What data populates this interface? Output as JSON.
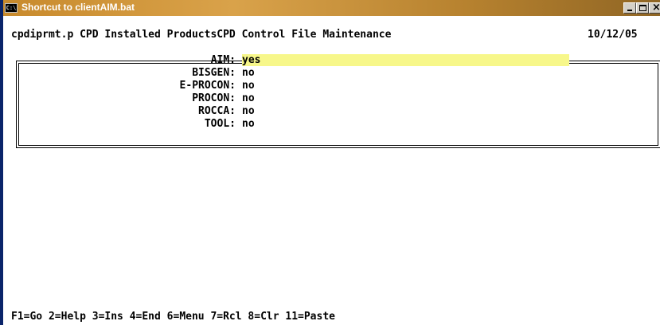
{
  "window": {
    "title": "Shortcut to clientAIM.bat",
    "icon": "C:\\",
    "controls": [
      "minimize-icon",
      "maximize-icon",
      "close-icon"
    ]
  },
  "header": {
    "left": "cpdiprmt.p CPD Installed ProductsCPD Control File Maintenance",
    "date": "10/12/05"
  },
  "fields": [
    {
      "label": "AIM:",
      "value": "yes",
      "active": true
    },
    {
      "label": "BISGEN:",
      "value": "no"
    },
    {
      "label": "E-PROCON:",
      "value": "no"
    },
    {
      "label": "PROCON:",
      "value": "no"
    },
    {
      "label": "ROCCA:",
      "value": "no"
    },
    {
      "label": "TOOL:",
      "value": "no"
    }
  ],
  "footer": {
    "keys": "F1=Go 2=Help 3=Ins 4=End 6=Menu 7=Rcl 8=Clr 11=Paste"
  },
  "colors": {
    "titlebar": "#c88a2c",
    "active_field": "#f7f78a",
    "text": "#000000",
    "background": "#ffffff"
  }
}
